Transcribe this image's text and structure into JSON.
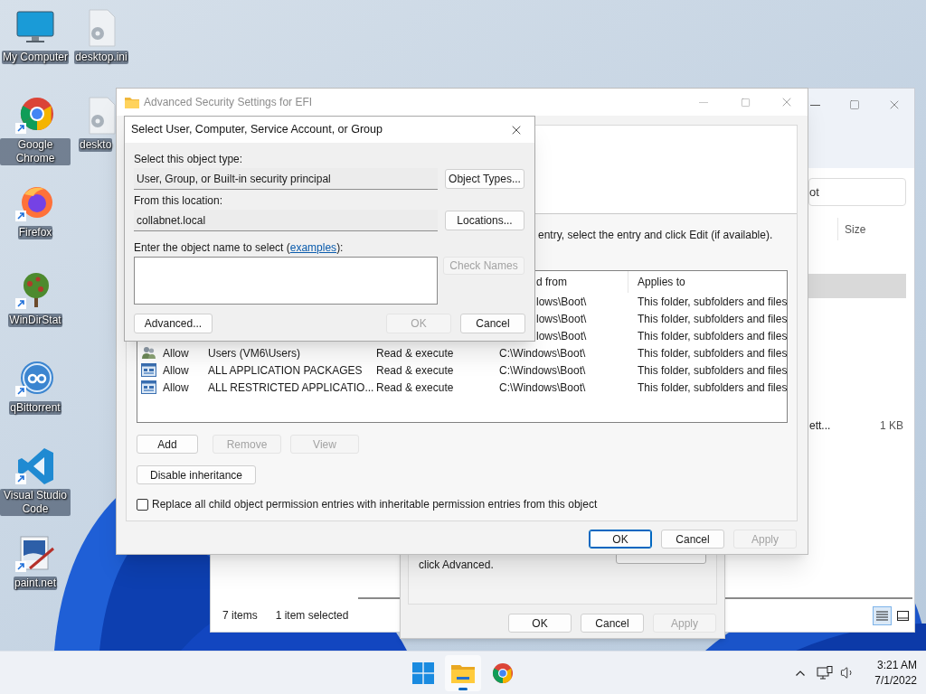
{
  "desktop": {
    "icons_column_1": [
      {
        "label": "My Computer",
        "kind": "monitor"
      },
      {
        "label": "Google Chrome",
        "kind": "chrome"
      },
      {
        "label": "Firefox",
        "kind": "firefox"
      },
      {
        "label": "WinDirStat",
        "kind": "tree"
      },
      {
        "label": "qBittorrent",
        "kind": "qb"
      },
      {
        "label": "Visual Studio Code",
        "kind": "vscode"
      },
      {
        "label": "paint.net",
        "kind": "paint"
      }
    ],
    "icons_column_2": [
      {
        "label": "desktop.ini",
        "kind": "ini"
      },
      {
        "label": "deskto",
        "kind": "ini"
      }
    ]
  },
  "explorer": {
    "search_text": "ot",
    "columns": [
      {
        "label": "Size"
      }
    ],
    "rows": [
      {
        "selected": true
      },
      {
        "name": "ett...",
        "size": "1 KB",
        "selected": false
      }
    ],
    "status": {
      "count": "7 items",
      "selection": "1 item selected"
    },
    "views": [
      {
        "kind": "details",
        "selected": true
      },
      {
        "kind": "tiles",
        "selected": false
      }
    ]
  },
  "properties": {
    "text": "click Advanced.",
    "advanced_button": {
      "disabled": false
    },
    "buttons": [
      {
        "label": "OK",
        "disabled": false
      },
      {
        "label": "Cancel",
        "disabled": false
      },
      {
        "label": "Apply",
        "disabled": true
      }
    ]
  },
  "security": {
    "title": "Advanced Security Settings for EFI",
    "instruction": "entry, select the entry and click Edit (if available).",
    "table": {
      "columns": [
        {
          "label": "d from"
        },
        {
          "label": "Applies to"
        }
      ],
      "rows": [
        {
          "kind": "partial",
          "inherited_from": "lows\\Boot\\",
          "applies_to": "This folder, subfolders and files"
        },
        {
          "kind": "partial",
          "inherited_from": "lows\\Boot\\",
          "applies_to": "This folder, subfolders and files"
        },
        {
          "kind": "partial",
          "inherited_from": "lows\\Boot\\",
          "applies_to": "This folder, subfolders and files"
        },
        {
          "kind": "users",
          "type": "Allow",
          "principal": "Users (VM6\\Users)",
          "access": "Read & execute",
          "inherited_from": "C:\\Windows\\Boot\\",
          "applies_to": "This folder, subfolders and files"
        },
        {
          "kind": "package",
          "type": "Allow",
          "principal": "ALL APPLICATION PACKAGES",
          "access": "Read & execute",
          "inherited_from": "C:\\Windows\\Boot\\",
          "applies_to": "This folder, subfolders and files"
        },
        {
          "kind": "package",
          "type": "Allow",
          "principal": "ALL RESTRICTED APPLICATIO...",
          "access": "Read & execute",
          "inherited_from": "C:\\Windows\\Boot\\",
          "applies_to": "This folder, subfolders and files"
        }
      ]
    },
    "entry_buttons": [
      {
        "label": "Add",
        "disabled": false
      },
      {
        "label": "Remove",
        "disabled": true
      },
      {
        "label": "View",
        "disabled": true
      }
    ],
    "inheritance_button": {
      "label": "Disable inheritance",
      "disabled": false
    },
    "replace_checkbox": {
      "label": "Replace all child object permission entries with inheritable permission entries from this object",
      "checked": false
    },
    "buttons": [
      {
        "label": "OK",
        "disabled": false,
        "default": true
      },
      {
        "label": "Cancel",
        "disabled": false,
        "default": false
      },
      {
        "label": "Apply",
        "disabled": true,
        "default": false
      }
    ]
  },
  "select_dialog": {
    "title": "Select User, Computer, Service Account, or Group",
    "object_type_label": "Select this object type:",
    "object_type": "User, Group, or Built-in security principal",
    "object_types_button": {
      "label": "Object Types...",
      "disabled": false
    },
    "location_label": "From this location:",
    "location": "collabnet.local",
    "locations_button": {
      "label": "Locations...",
      "disabled": false
    },
    "name_label": "Enter the object name to select (",
    "name_link": "examples",
    "name_label_end": "):",
    "check_names_button": {
      "label": "Check Names",
      "disabled": true
    },
    "advanced_button": {
      "label": "Advanced...",
      "disabled": false
    },
    "buttons": [
      {
        "label": "OK",
        "disabled": true
      },
      {
        "label": "Cancel",
        "disabled": false
      }
    ]
  },
  "taskbar": {
    "apps": [
      {
        "kind": "start",
        "active": false
      },
      {
        "kind": "explorer",
        "active": true
      },
      {
        "kind": "chrome",
        "active": false
      }
    ],
    "time": "3:21 AM",
    "date": "7/1/2022"
  }
}
